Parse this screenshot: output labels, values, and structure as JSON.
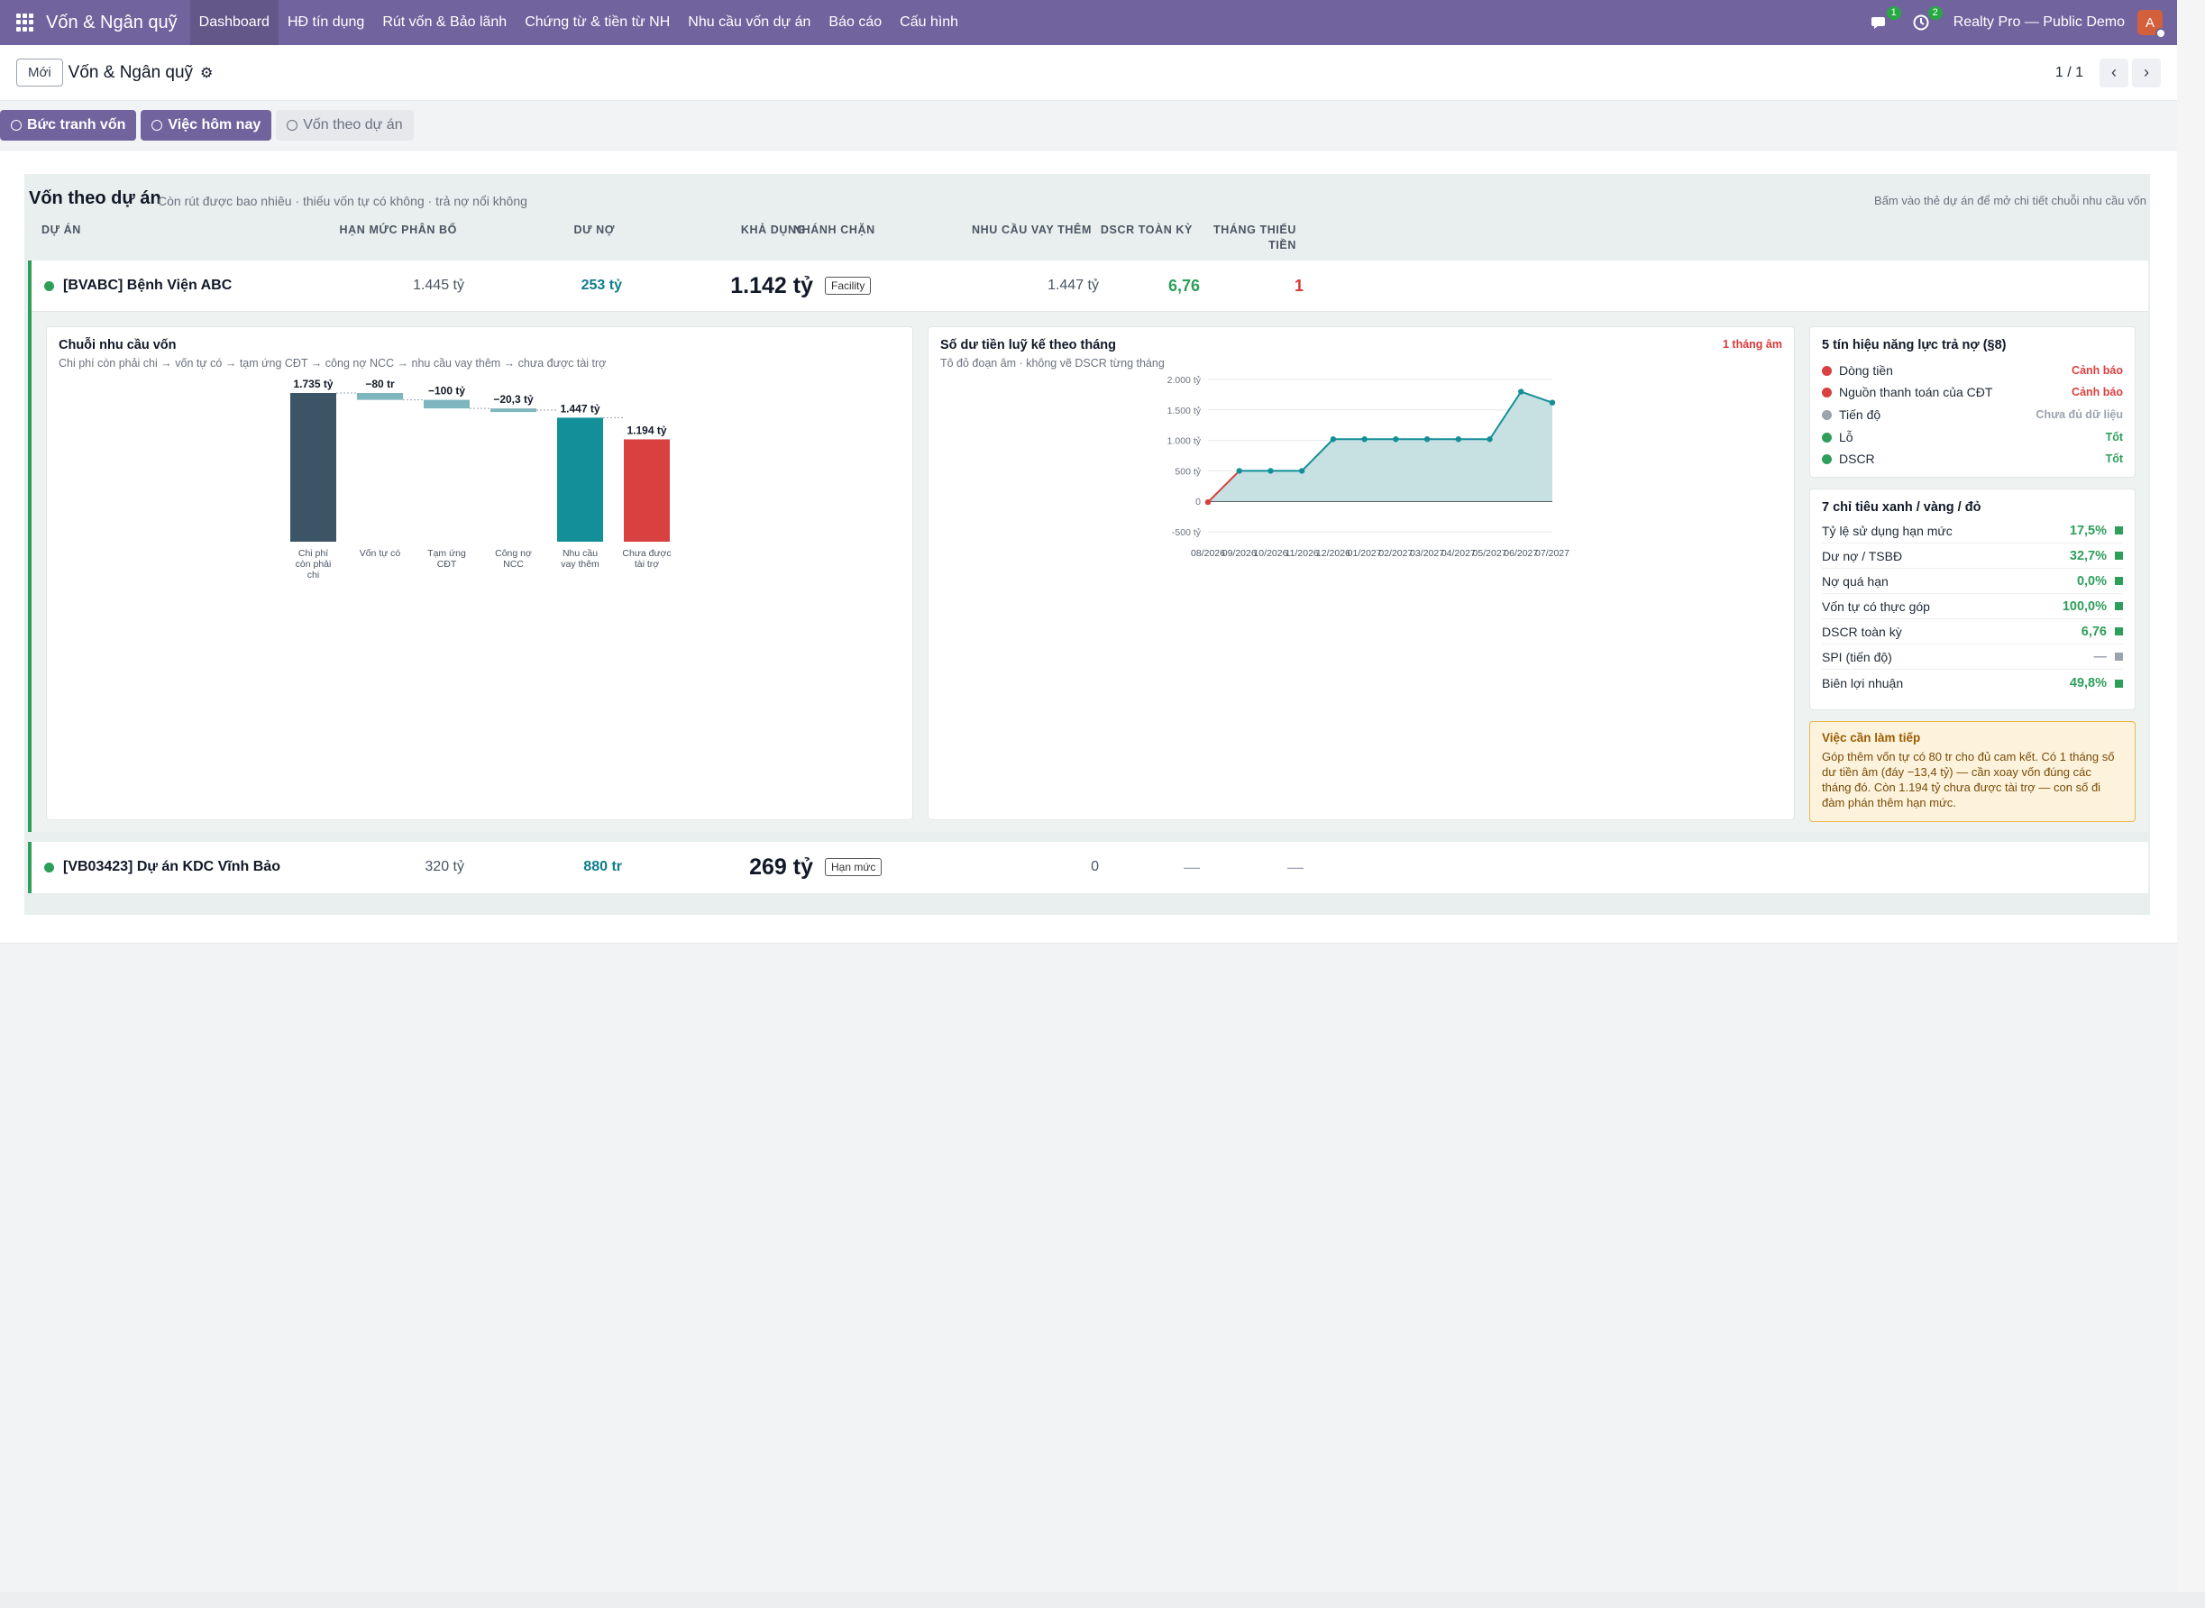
{
  "navbar": {
    "app_name": "Vốn & Ngân quỹ",
    "items": [
      "Dashboard",
      "HĐ tín dụng",
      "Rút vốn & Bảo lãnh",
      "Chứng từ & tiền từ NH",
      "Nhu cầu vốn dự án",
      "Báo cáo",
      "Cấu hình"
    ],
    "messages_badge": "1",
    "activity_badge": "2",
    "company": "Realty Pro — Public Demo",
    "avatar_letter": "A"
  },
  "control": {
    "new_label": "Mới",
    "title": "Vốn & Ngân quỹ",
    "pager": "1 / 1"
  },
  "tabs": [
    "Bức tranh vốn",
    "Việc hôm nay",
    "Vốn theo dự án"
  ],
  "panel": {
    "title": "Vốn theo dự án",
    "subtitle": "Còn rút được bao nhiêu · thiếu vốn tự có không · trả nợ nổi không",
    "hint": "Bấm vào thẻ dự án để mở chi tiết chuỗi nhu cầu vốn",
    "headers": {
      "project": "DỰ ÁN",
      "limit": "HẠN MỨC PHÂN BỔ",
      "debt": "DƯ NỢ",
      "available": "KHẢ DỤNG",
      "branch": "NHÁNH CHẶN",
      "need": "NHU CẦU VAY THÊM",
      "dscr": "DSCR TOÀN KỲ",
      "months_l1": "THÁNG THIẾU",
      "months_l2": "TIỀN"
    }
  },
  "projects": [
    {
      "name": "[BVABC] Bệnh Viện ABC",
      "limit": "1.445 tỷ",
      "debt": "253 tỷ",
      "available": "1.142 tỷ",
      "branch_tag": "Facility",
      "need": "1.447 tỷ",
      "dscr": "6,76",
      "months_short": "1"
    },
    {
      "name": "[VB03423] Dự án KDC Vĩnh Bảo",
      "limit": "320 tỷ",
      "debt": "880 tr",
      "available": "269 tỷ",
      "branch_tag": "Hạn mức",
      "need": "0",
      "dscr": "—",
      "months_short": "—"
    }
  ],
  "chart_data": [
    {
      "type": "bar",
      "subtype": "waterfall",
      "title": "Chuỗi nhu cầu vốn",
      "subtitle": "Chi phí còn phải chi → vốn tự có → tạm ứng CĐT → công nợ NCC → nhu cầu vay thêm → chưa được tài trợ",
      "categories": [
        "Chi phí còn phải chi",
        "Vốn tự có",
        "Tạm ứng CĐT",
        "Công nợ NCC",
        "Nhu cầu vay thêm",
        "Chưa được tài trợ"
      ],
      "values": [
        1735,
        -80,
        -100,
        -20.3,
        1447,
        1194
      ],
      "value_labels": [
        "1.735 tỷ",
        "−80 tr",
        "−100 tỷ",
        "−20,3 tỷ",
        "1.447 tỷ",
        "1.194 tỷ"
      ],
      "colors": [
        "#3b5566",
        "#7fb6bd",
        "#7fb6bd",
        "#7fb6bd",
        "#138f99",
        "#d94040"
      ]
    },
    {
      "type": "area",
      "title": "Số dư tiền luỹ kế theo tháng",
      "subtitle": "Tô đỏ đoạn âm · không vẽ DSCR từng tháng",
      "flag": "1 tháng âm",
      "x": [
        "08/2026",
        "09/2026",
        "10/2026",
        "11/2026",
        "12/2026",
        "01/2027",
        "02/2027",
        "03/2027",
        "04/2027",
        "05/2027",
        "06/2027",
        "07/2027"
      ],
      "values": [
        -13.4,
        500,
        500,
        500,
        1020,
        1020,
        1020,
        1020,
        1020,
        1020,
        1800,
        1620
      ],
      "ylim": [
        -500,
        2000
      ],
      "yticks": [
        "2.000 tỷ",
        "1.500 tỷ",
        "1.000 tỷ",
        "500 tỷ",
        "0",
        "-500 tỷ"
      ],
      "negative_color": "#d94040",
      "line_color": "#138f99",
      "fill_color": "#c7e0e2"
    }
  ],
  "signals": {
    "title": "5 tín hiệu năng lực trả nợ (§8)",
    "items": [
      {
        "label": "Dòng tiền",
        "value": "Cảnh báo",
        "color": "#d94040",
        "value_color": "#d94040"
      },
      {
        "label": "Nguồn thanh toán của CĐT",
        "value": "Cảnh báo",
        "color": "#d94040",
        "value_color": "#d94040"
      },
      {
        "label": "Tiến độ",
        "value": "Chưa đủ dữ liệu",
        "color": "#9ca3af",
        "value_color": "#9ca3af"
      },
      {
        "label": "Lỗ",
        "value": "Tốt",
        "color": "#2e9e5b",
        "value_color": "#2e9e5b"
      },
      {
        "label": "DSCR",
        "value": "Tốt",
        "color": "#2e9e5b",
        "value_color": "#2e9e5b"
      }
    ]
  },
  "kpis": {
    "title": "7 chỉ tiêu xanh / vàng / đỏ",
    "items": [
      {
        "label": "Tỷ lệ sử dụng hạn mức",
        "value": "17,5%",
        "color": "#2e9e5b"
      },
      {
        "label": "Dư nợ / TSBĐ",
        "value": "32,7%",
        "color": "#2e9e5b"
      },
      {
        "label": "Nợ quá hạn",
        "value": "0,0%",
        "color": "#2e9e5b"
      },
      {
        "label": "Vốn tự có thực góp",
        "value": "100,0%",
        "color": "#2e9e5b"
      },
      {
        "label": "DSCR toàn kỳ",
        "value": "6,76",
        "color": "#2e9e5b"
      },
      {
        "label": "SPI (tiến độ)",
        "value": "—",
        "color": "#9ca3af"
      },
      {
        "label": "Biên lợi nhuận",
        "value": "49,8%",
        "color": "#2e9e5b"
      }
    ]
  },
  "todo": {
    "title": "Việc cần làm tiếp",
    "body": "Góp thêm vốn tự có 80 tr cho đủ cam kết. Có 1 tháng số dư tiền âm (đáy −13,4 tỷ) — cần xoay vốn đúng các tháng đó. Còn 1.194 tỷ chưa được tài trợ — con số đi đàm phán thêm hạn mức."
  },
  "icons": {
    "apps": "apps-grid-icon",
    "messages": "chat-icon",
    "activity": "clock-icon",
    "settings": "gear-icon",
    "prev": "chevron-left-icon",
    "next": "chevron-right-icon"
  }
}
